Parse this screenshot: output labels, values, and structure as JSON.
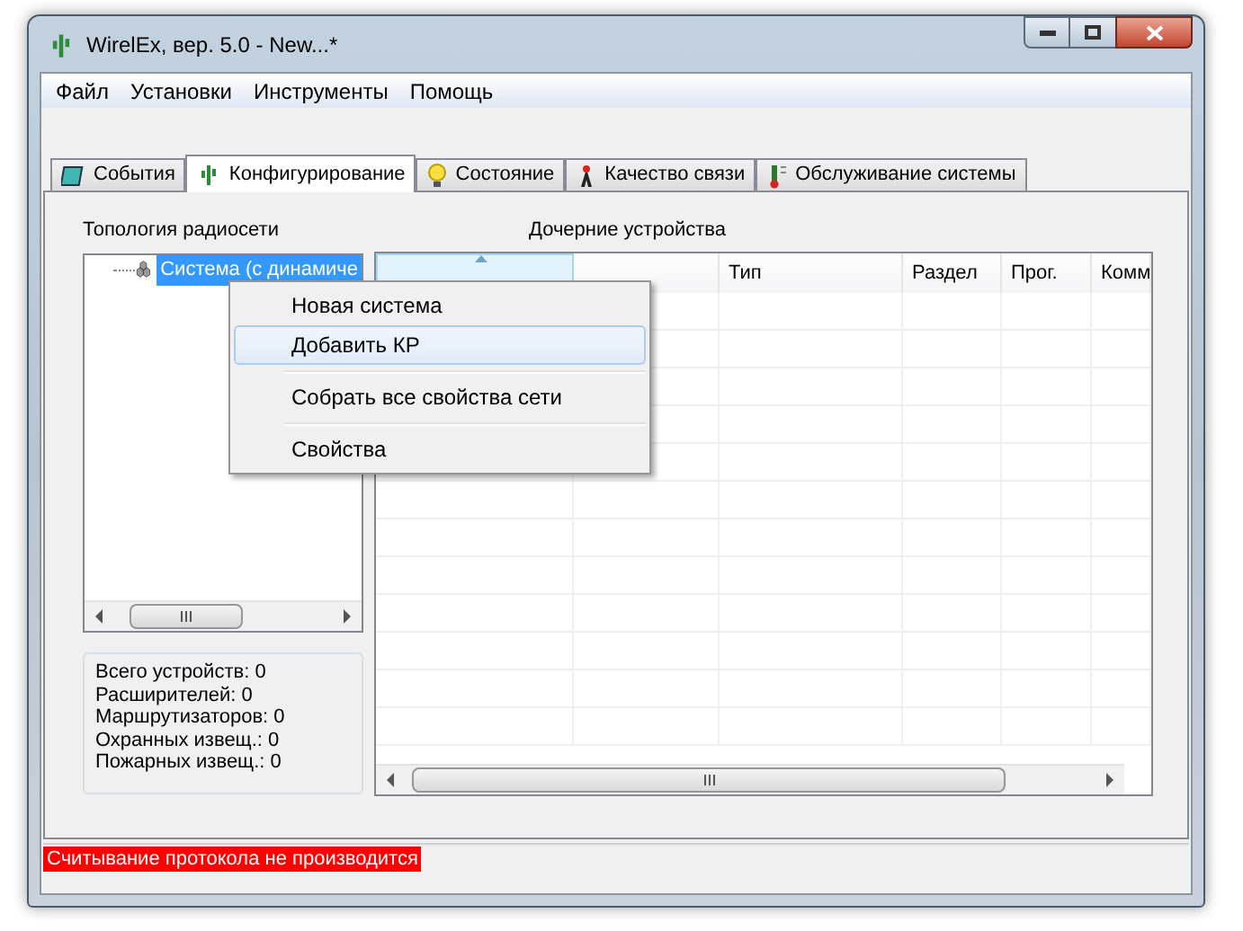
{
  "window": {
    "title": "WirelEx, вер. 5.0 - New...*"
  },
  "menu": [
    "Файл",
    "Установки",
    "Инструменты",
    "Помощь"
  ],
  "tabs": [
    {
      "label": "События",
      "selected": false,
      "kind": "events"
    },
    {
      "label": "Конфигурирование",
      "selected": true,
      "kind": "config"
    },
    {
      "label": "Состояние",
      "selected": false,
      "kind": "state"
    },
    {
      "label": "Качество связи",
      "selected": false,
      "kind": "link"
    },
    {
      "label": "Обслуживание системы",
      "selected": false,
      "kind": "service"
    }
  ],
  "topology": {
    "title": "Топология радиосети",
    "tree": [
      {
        "label": "Система (с динамиче",
        "selected": true
      }
    ]
  },
  "stats": [
    "Всего устройств: 0",
    "Расширителей: 0",
    "Маршрутизаторов: 0",
    "Охранных извещ.: 0",
    "Пожарных извещ.: 0"
  ],
  "devices": {
    "title": "Дочерние устройства",
    "columns": [
      {
        "sorted": true
      },
      {
        "sorted": false
      },
      {
        "label": "Тип",
        "sorted": false
      },
      {
        "label": "Раздел",
        "sorted": false
      },
      {
        "label": "Прог.",
        "sorted": false
      },
      {
        "label": "Комм",
        "sorted": false
      }
    ]
  },
  "context_menu": [
    {
      "kind": "item",
      "label": "Новая система",
      "selected": false
    },
    {
      "kind": "item",
      "label": "Добавить КР",
      "selected": true
    },
    {
      "kind": "separator"
    },
    {
      "kind": "item",
      "label": "Собрать все свойства сети",
      "selected": false
    },
    {
      "kind": "separator"
    },
    {
      "kind": "item",
      "label": "Свойства",
      "selected": false
    }
  ],
  "status_bar": {
    "text": "Считывание протокола не производится"
  }
}
